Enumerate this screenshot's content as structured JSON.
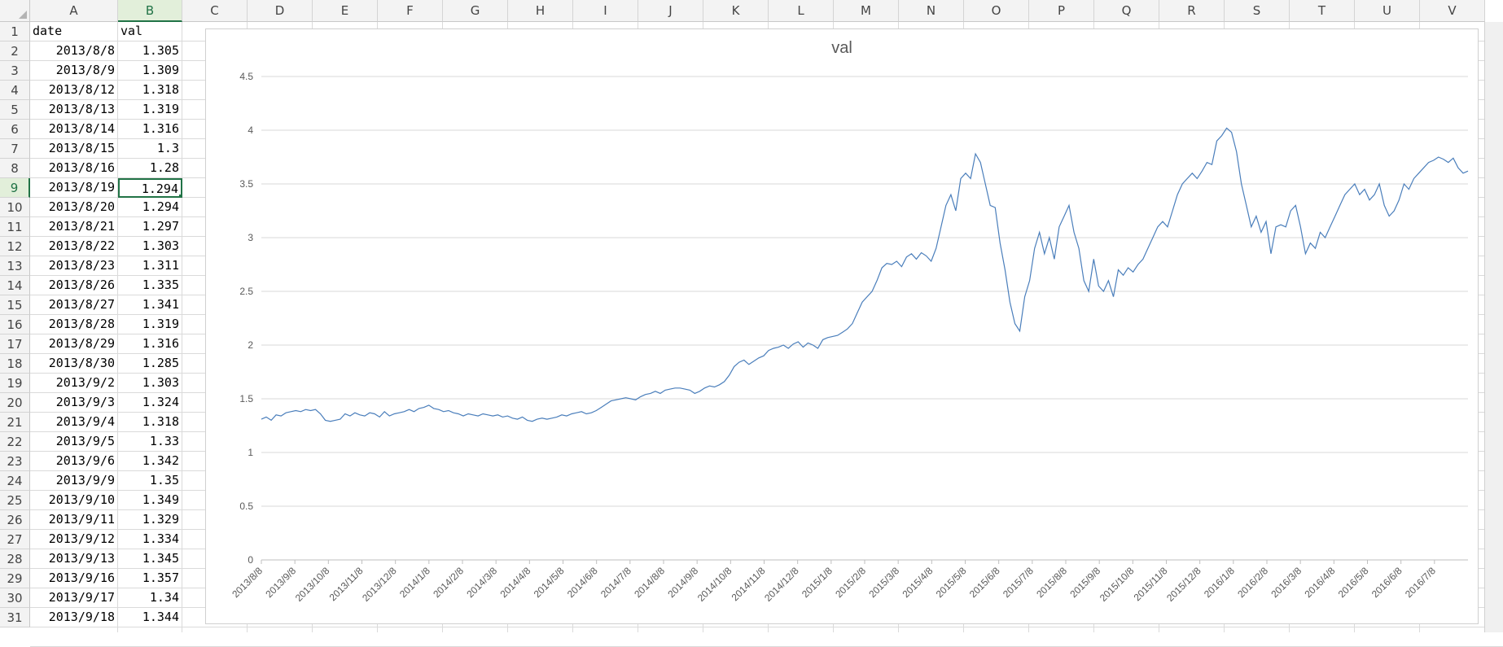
{
  "spreadsheet": {
    "columns": [
      "A",
      "B",
      "C",
      "D",
      "E",
      "F",
      "G",
      "H",
      "I",
      "J",
      "K",
      "L",
      "M",
      "N",
      "O",
      "P",
      "Q",
      "R",
      "S",
      "T",
      "U",
      "V"
    ],
    "selected_column": "B",
    "selected_row": "9",
    "rows": [
      {
        "n": "1",
        "a": "date",
        "b": "val"
      },
      {
        "n": "2",
        "a": "2013/8/8",
        "b": "1.305"
      },
      {
        "n": "3",
        "a": "2013/8/9",
        "b": "1.309"
      },
      {
        "n": "4",
        "a": "2013/8/12",
        "b": "1.318"
      },
      {
        "n": "5",
        "a": "2013/8/13",
        "b": "1.319"
      },
      {
        "n": "6",
        "a": "2013/8/14",
        "b": "1.316"
      },
      {
        "n": "7",
        "a": "2013/8/15",
        "b": "1.3"
      },
      {
        "n": "8",
        "a": "2013/8/16",
        "b": "1.28"
      },
      {
        "n": "9",
        "a": "2013/8/19",
        "b": "1.294"
      },
      {
        "n": "10",
        "a": "2013/8/20",
        "b": "1.294"
      },
      {
        "n": "11",
        "a": "2013/8/21",
        "b": "1.297"
      },
      {
        "n": "12",
        "a": "2013/8/22",
        "b": "1.303"
      },
      {
        "n": "13",
        "a": "2013/8/23",
        "b": "1.311"
      },
      {
        "n": "14",
        "a": "2013/8/26",
        "b": "1.335"
      },
      {
        "n": "15",
        "a": "2013/8/27",
        "b": "1.341"
      },
      {
        "n": "16",
        "a": "2013/8/28",
        "b": "1.319"
      },
      {
        "n": "17",
        "a": "2013/8/29",
        "b": "1.316"
      },
      {
        "n": "18",
        "a": "2013/8/30",
        "b": "1.285"
      },
      {
        "n": "19",
        "a": "2013/9/2",
        "b": "1.303"
      },
      {
        "n": "20",
        "a": "2013/9/3",
        "b": "1.324"
      },
      {
        "n": "21",
        "a": "2013/9/4",
        "b": "1.318"
      },
      {
        "n": "22",
        "a": "2013/9/5",
        "b": "1.33"
      },
      {
        "n": "23",
        "a": "2013/9/6",
        "b": "1.342"
      },
      {
        "n": "24",
        "a": "2013/9/9",
        "b": "1.35"
      },
      {
        "n": "25",
        "a": "2013/9/10",
        "b": "1.349"
      },
      {
        "n": "26",
        "a": "2013/9/11",
        "b": "1.329"
      },
      {
        "n": "27",
        "a": "2013/9/12",
        "b": "1.334"
      },
      {
        "n": "28",
        "a": "2013/9/13",
        "b": "1.345"
      },
      {
        "n": "29",
        "a": "2013/9/16",
        "b": "1.357"
      },
      {
        "n": "30",
        "a": "2013/9/17",
        "b": "1.34"
      },
      {
        "n": "31",
        "a": "2013/9/18",
        "b": "1.344"
      }
    ]
  },
  "chart_data": {
    "type": "line",
    "title": "val",
    "xlabel": "",
    "ylabel": "",
    "ylim": [
      0,
      4.5
    ],
    "yticks": [
      "0",
      "0.5",
      "1",
      "1.5",
      "2",
      "2.5",
      "3",
      "3.5",
      "4",
      "4.5"
    ],
    "xtick_labels": [
      "2013/8/8",
      "2013/9/8",
      "2013/10/8",
      "2013/11/8",
      "2013/12/8",
      "2014/1/8",
      "2014/2/8",
      "2014/3/8",
      "2014/4/8",
      "2014/5/8",
      "2014/6/8",
      "2014/7/8",
      "2014/8/8",
      "2014/9/8",
      "2014/10/8",
      "2014/11/8",
      "2014/12/8",
      "2015/1/8",
      "2015/2/8",
      "2015/3/8",
      "2015/4/8",
      "2015/5/8",
      "2015/6/8",
      "2015/7/8",
      "2015/8/8",
      "2015/9/8",
      "2015/10/8",
      "2015/11/8",
      "2015/12/8",
      "2016/1/8",
      "2016/2/8",
      "2016/3/8",
      "2016/4/8",
      "2016/5/8",
      "2016/6/8",
      "2016/7/8"
    ],
    "grid": true,
    "legend": "none",
    "line_color": "#4a7ebb",
    "series": [
      {
        "x": "2013/8/8",
        "values": [
          1.31,
          1.33,
          1.3,
          1.35,
          1.34,
          1.37,
          1.38,
          1.39,
          1.38,
          1.4,
          1.39,
          1.4,
          1.36,
          1.3,
          1.29,
          1.3,
          1.31,
          1.36,
          1.34,
          1.37,
          1.35,
          1.34,
          1.37,
          1.36,
          1.33,
          1.38,
          1.34,
          1.36,
          1.37,
          1.38,
          1.4,
          1.38,
          1.41,
          1.42,
          1.44,
          1.41,
          1.4,
          1.38,
          1.39,
          1.37,
          1.36,
          1.34,
          1.36,
          1.35,
          1.34,
          1.36,
          1.35,
          1.34,
          1.35,
          1.33,
          1.34,
          1.32,
          1.31,
          1.33,
          1.3,
          1.29,
          1.31,
          1.32,
          1.31,
          1.32,
          1.33,
          1.35,
          1.34,
          1.36,
          1.37,
          1.38,
          1.36,
          1.37,
          1.39,
          1.42,
          1.45,
          1.48,
          1.49,
          1.5,
          1.51,
          1.5,
          1.49,
          1.52,
          1.54,
          1.55,
          1.57,
          1.55,
          1.58,
          1.59,
          1.6,
          1.6,
          1.59,
          1.58,
          1.55,
          1.57,
          1.6,
          1.62,
          1.61,
          1.63,
          1.66,
          1.72,
          1.8,
          1.84,
          1.86,
          1.82,
          1.85,
          1.88,
          1.9,
          1.95,
          1.97,
          1.98,
          2.0,
          1.97,
          2.01,
          2.03,
          1.98,
          2.02,
          2.0,
          1.97,
          2.05,
          2.07,
          2.08,
          2.09,
          2.12,
          2.15,
          2.2,
          2.3,
          2.4,
          2.45,
          2.5,
          2.6,
          2.72,
          2.76,
          2.75,
          2.78,
          2.73,
          2.82,
          2.85,
          2.8,
          2.86,
          2.83,
          2.78,
          2.9,
          3.1,
          3.3,
          3.4,
          3.25,
          3.55,
          3.6,
          3.55,
          3.78,
          3.7,
          3.5,
          3.3,
          3.28,
          2.95,
          2.7,
          2.4,
          2.2,
          2.13,
          2.45,
          2.6,
          2.9,
          3.05,
          2.85,
          3.0,
          2.8,
          3.1,
          3.2,
          3.3,
          3.05,
          2.9,
          2.6,
          2.5,
          2.8,
          2.55,
          2.5,
          2.6,
          2.45,
          2.7,
          2.65,
          2.72,
          2.68,
          2.75,
          2.8,
          2.9,
          3.0,
          3.1,
          3.15,
          3.1,
          3.25,
          3.4,
          3.5,
          3.55,
          3.6,
          3.55,
          3.62,
          3.7,
          3.68,
          3.9,
          3.95,
          4.02,
          3.98,
          3.8,
          3.5,
          3.3,
          3.1,
          3.2,
          3.05,
          3.15,
          2.85,
          3.1,
          3.12,
          3.1,
          3.25,
          3.3,
          3.1,
          2.85,
          2.95,
          2.9,
          3.05,
          3.0,
          3.1,
          3.2,
          3.3,
          3.4,
          3.45,
          3.5,
          3.4,
          3.45,
          3.35,
          3.4,
          3.5,
          3.3,
          3.2,
          3.25,
          3.35,
          3.5,
          3.45,
          3.55,
          3.6,
          3.65,
          3.7,
          3.72,
          3.75,
          3.73,
          3.7,
          3.74,
          3.65,
          3.6,
          3.62
        ]
      }
    ]
  }
}
